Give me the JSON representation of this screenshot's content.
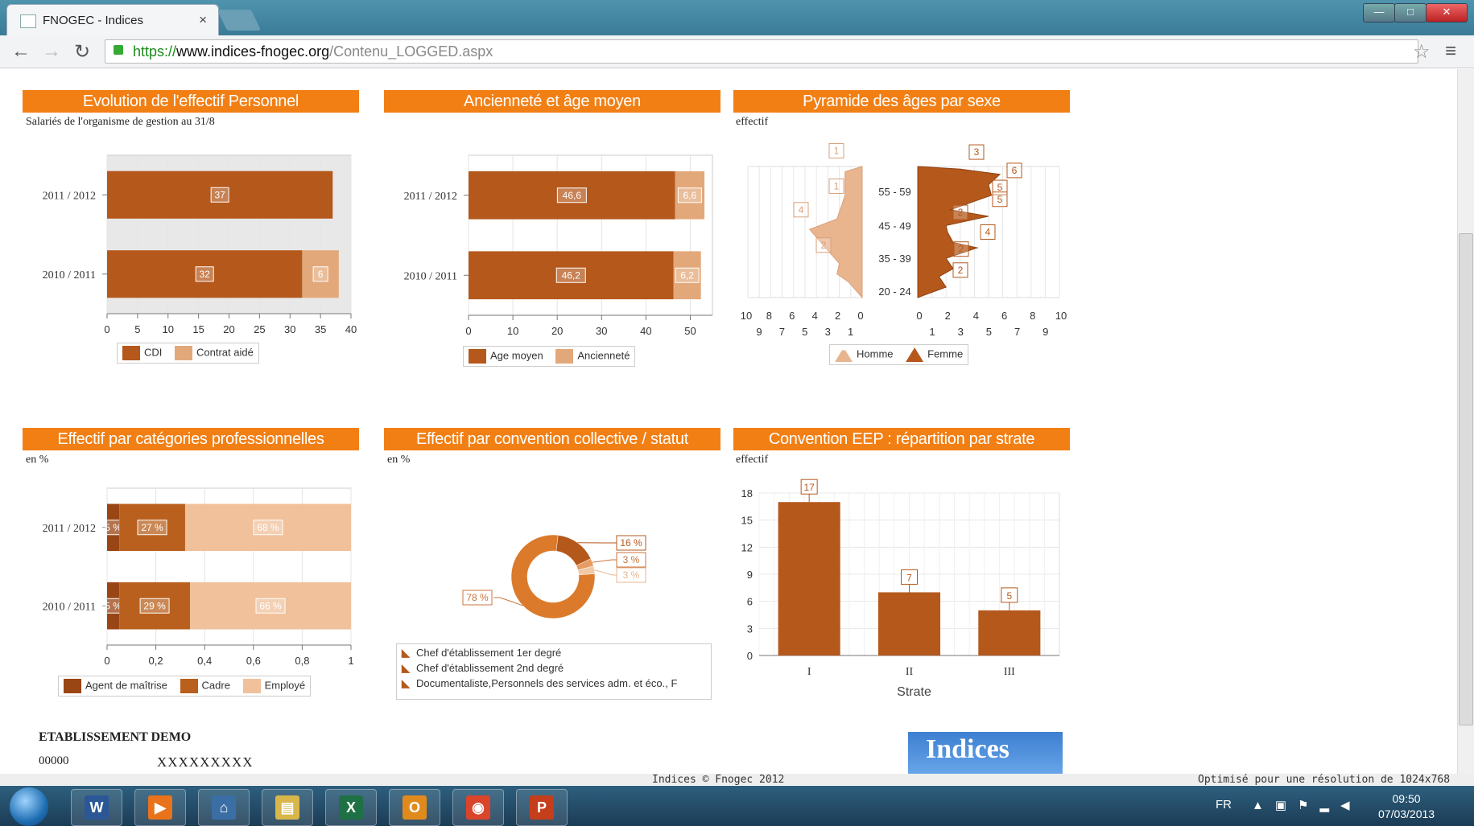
{
  "browser": {
    "tab_title": "FNOGEC - Indices",
    "url_scheme": "https://",
    "url_host": "www.indices-fnogec.org",
    "url_path": "/Contenu_LOGGED.aspx"
  },
  "panels": {
    "effectif": {
      "title": "Evolution de l'effectif Personnel",
      "subtitle": "Salariés de l'organisme de gestion au 31/8"
    },
    "anciennete": {
      "title": "Ancienneté et âge moyen"
    },
    "pyramide": {
      "title": "Pyramide des âges par sexe",
      "subtitle": "effectif"
    },
    "categories": {
      "title": "Effectif par catégories professionnelles",
      "subtitle": "en %"
    },
    "convention": {
      "title": "Effectif par convention collective / statut",
      "subtitle": "en %"
    },
    "eep": {
      "title": "Convention EEP : répartition par strate",
      "subtitle": "effectif"
    }
  },
  "chart_data": [
    {
      "id": "effectif",
      "type": "bar",
      "orientation": "horizontal",
      "stacked": true,
      "categories": [
        "2011 / 2012",
        "2010 / 2011"
      ],
      "series": [
        {
          "name": "CDI",
          "values": [
            37,
            32
          ],
          "color": "#b5581c"
        },
        {
          "name": "Contrat aidé",
          "values": [
            0,
            6
          ],
          "color": "#e3a87a"
        }
      ],
      "data_labels": [
        [
          "37",
          ""
        ],
        [
          "32",
          "6"
        ]
      ],
      "xlim": [
        0,
        40
      ],
      "xticks": [
        "0",
        "5",
        "10",
        "15",
        "20",
        "25",
        "30",
        "35",
        "40"
      ]
    },
    {
      "id": "anciennete",
      "type": "bar",
      "orientation": "horizontal",
      "stacked": true,
      "categories": [
        "2011 / 2012",
        "2010 / 2011"
      ],
      "series": [
        {
          "name": "Age moyen",
          "values": [
            46.6,
            46.2
          ],
          "color": "#b5581c"
        },
        {
          "name": "Ancienneté",
          "values": [
            6.6,
            6.2
          ],
          "color": "#e3a87a"
        }
      ],
      "data_labels": [
        [
          "46,6",
          "6,6"
        ],
        [
          "46,2",
          "6,2"
        ]
      ],
      "xlim": [
        0,
        55
      ],
      "xticks": [
        "0",
        "10",
        "20",
        "30",
        "40",
        "50"
      ]
    },
    {
      "id": "pyramide",
      "type": "area",
      "orientation": "pyramid",
      "age_labels": [
        "55 - 59",
        "45 - 49",
        "35 - 39",
        "20 - 24"
      ],
      "homme_labels": [
        "1",
        "1",
        "4",
        "2"
      ],
      "femme_labels": [
        "3",
        "6",
        "5",
        "5",
        "2",
        "4",
        "2",
        "2"
      ],
      "xticks_top_left": [
        "10",
        "8",
        "6",
        "4",
        "2",
        "0"
      ],
      "xticks_bottom_left": [
        "9",
        "7",
        "5",
        "3",
        "1"
      ],
      "xticks_top_right": [
        "0",
        "2",
        "4",
        "6",
        "8",
        "10"
      ],
      "xticks_bottom_right": [
        "1",
        "3",
        "5",
        "7",
        "9"
      ],
      "series": [
        {
          "name": "Homme",
          "color": "#e8b58f"
        },
        {
          "name": "Femme",
          "color": "#b5581c"
        }
      ]
    },
    {
      "id": "categories",
      "type": "bar",
      "orientation": "horizontal",
      "stacked": true,
      "categories": [
        "2011 / 2012",
        "2010 / 2011"
      ],
      "series": [
        {
          "name": "Agent de maîtrise",
          "values": [
            0.05,
            0.05
          ],
          "color": "#9a4514"
        },
        {
          "name": "Cadre",
          "values": [
            0.27,
            0.29
          ],
          "color": "#b9601e"
        },
        {
          "name": "Employé",
          "values": [
            0.68,
            0.66
          ],
          "color": "#f0c19b"
        }
      ],
      "data_labels": [
        [
          "5 %",
          "27 %",
          "68 %"
        ],
        [
          "5 %",
          "29 %",
          "66 %"
        ]
      ],
      "xlim": [
        0,
        1
      ],
      "xticks": [
        "0",
        "0,2",
        "0,4",
        "0,6",
        "0,8",
        "1"
      ]
    },
    {
      "id": "convention",
      "type": "pie",
      "donut": true,
      "slices": [
        {
          "label": "78 %",
          "value": 78,
          "color": "#db7a2a"
        },
        {
          "label": "16 %",
          "value": 16,
          "color": "#b5581c"
        },
        {
          "label": "3 %",
          "value": 3,
          "color": "#e79c62"
        },
        {
          "label": "3 %",
          "value": 3,
          "color": "#f2c9a6"
        }
      ],
      "legend": [
        "Chef d'établissement 1er degré",
        "Chef d'établissement 2nd degré",
        "Documentaliste,Personnels des services adm. et éco., F"
      ]
    },
    {
      "id": "eep",
      "type": "bar",
      "categories": [
        "I",
        "II",
        "III"
      ],
      "values": [
        17,
        7,
        5
      ],
      "color": "#b5581c",
      "ylim": [
        0,
        18
      ],
      "yticks": [
        "0",
        "3",
        "6",
        "9",
        "12",
        "15",
        "18"
      ],
      "xlabel": "Strate"
    }
  ],
  "footer": {
    "etablissement": "ETABLISSEMENT DEMO",
    "code": "00000",
    "code_value": "XXXXXXXXX",
    "logo_text": "Indices",
    "copyright": "Indices © Fnogec 2012",
    "optimise": "Optimisé pour une résolution de 1024x768"
  },
  "taskbar": {
    "lang": "FR",
    "time": "09:50",
    "date": "07/03/2013",
    "apps": [
      {
        "icon": "word-icon",
        "letter": "W",
        "color": "#2b5797"
      },
      {
        "icon": "media-player-icon",
        "letter": "▶",
        "color": "#e8731b"
      },
      {
        "icon": "network-icon",
        "letter": "⌂",
        "color": "#3a6ea5"
      },
      {
        "icon": "explorer-icon",
        "letter": "▤",
        "color": "#d9b64a"
      },
      {
        "icon": "excel-icon",
        "letter": "X",
        "color": "#1e7145"
      },
      {
        "icon": "outlook-icon",
        "letter": "O",
        "color": "#e08a1e"
      },
      {
        "icon": "chrome-icon",
        "letter": "◉",
        "color": "#d9442b"
      },
      {
        "icon": "powerpoint-icon",
        "letter": "P",
        "color": "#c43e1c"
      }
    ]
  }
}
